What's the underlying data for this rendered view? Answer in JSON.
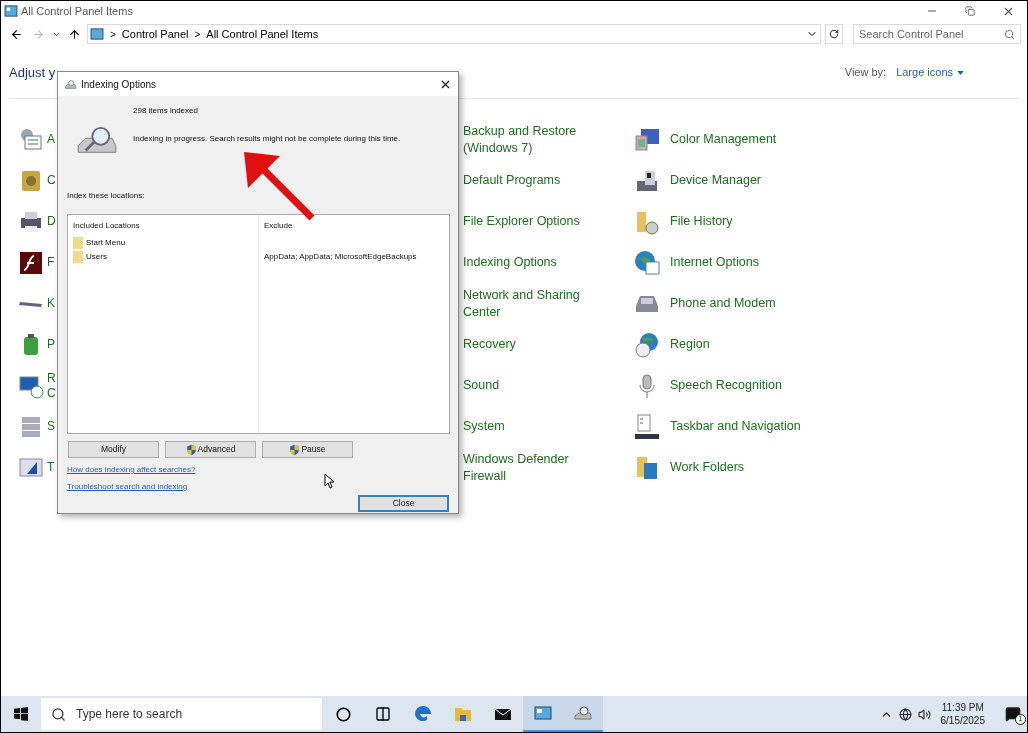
{
  "window": {
    "title": "All Control Panel Items",
    "breadcrumbs": [
      {
        "separator": ">",
        "label": "Control Panel"
      },
      {
        "separator": ">",
        "label": "All Control Panel Items"
      }
    ],
    "search": {
      "placeholder": "Search Control Panel"
    },
    "heading": "Adjust y",
    "view_by": {
      "label": "View by:",
      "value": "Large icons"
    }
  },
  "items": [
    {
      "left": "A",
      "middle": "Backup and Restore (Windows 7)",
      "right": "Color Management"
    },
    {
      "left": "C",
      "middle": "Default Programs",
      "right": "Device Manager"
    },
    {
      "left": "D",
      "middle": "File Explorer Options",
      "right": "File History"
    },
    {
      "left": "F",
      "middle": "Indexing Options",
      "right": "Internet Options"
    },
    {
      "left": "K",
      "middle": "Network and Sharing Center",
      "right": "Phone and Modem"
    },
    {
      "left": "P",
      "middle": "Recovery",
      "right": "Region"
    },
    {
      "left": "R C",
      "middle": "Sound",
      "right": "Speech Recognition"
    },
    {
      "left": "S",
      "middle": "System",
      "right": "Taskbar and Navigation"
    },
    {
      "left": "T",
      "middle": "Windows Defender Firewall",
      "right": "Work Folders"
    }
  ],
  "dialog": {
    "title": "Indexing Options",
    "count": "298 items indexed",
    "status": "Indexing in progress. Search results might not be complete during this time.",
    "locations_label": "Index these locations:",
    "columns": [
      "Included Locations",
      "Exclude"
    ],
    "rows": [
      {
        "location": "Start Menu"
      },
      {
        "location": "Users",
        "exclude": "AppData; AppData; MicrosoftEdgeBackups"
      }
    ],
    "buttons": [
      {
        "label": "Modify",
        "kind": "plain"
      },
      {
        "label": "Advanced",
        "kind": "shield"
      },
      {
        "label": "Pause",
        "kind": "shield"
      }
    ],
    "links": [
      "How does indexing affect searches?",
      "Troubleshoot search and indexing"
    ],
    "close": "Close"
  },
  "taskbar": {
    "search": {
      "placeholder": "Type here to search"
    },
    "apps": [
      {
        "active": false
      },
      {
        "active": false
      },
      {
        "active": false
      },
      {
        "active": false
      },
      {
        "active": false
      },
      {
        "active": true
      },
      {
        "active": true
      }
    ],
    "time": "11:39 PM",
    "date": "6/15/2025",
    "notifications": "1"
  }
}
